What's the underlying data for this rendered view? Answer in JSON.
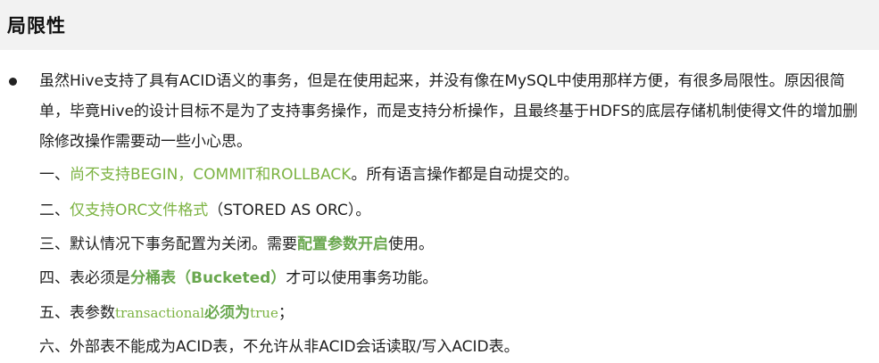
{
  "header": {
    "title": "局限性"
  },
  "paragraph": {
    "text": "虽然Hive支持了具有ACID语义的事务，但是在使用起来，并没有像在MySQL中使用那样方便，有很多局限性。原因很简单，毕竟Hive的设计目标不是为了支持事务操作，而是支持分析操作，且最终基于HDFS的底层存储机制使得文件的增加删除修改操作需要动一些小心思。"
  },
  "items": [
    {
      "num": "一、",
      "green": "尚不支持BEGIN，COMMIT和ROLLBACK",
      "rest": "。所有语言操作都是自动提交的。"
    },
    {
      "num": "二、",
      "green": "仅支持ORC文件格式",
      "rest": "（STORED AS ORC）。"
    },
    {
      "num": "三、",
      "pre": "默认情况下事务配置为关闭。需要",
      "green": "配置参数开启",
      "rest": "使用。"
    },
    {
      "num": "四、",
      "pre": "表必须是",
      "green": "分桶表（Bucketed）",
      "rest": "才可以使用事务功能。"
    },
    {
      "num": "五、",
      "pre": "表参数",
      "green1": "transactional",
      "green_bold": "必须为",
      "green2": "true",
      "rest": "；"
    },
    {
      "num": "六、",
      "text": "外部表不能成为ACID表，不允许从非ACID会话读取/写入ACID表。"
    }
  ]
}
